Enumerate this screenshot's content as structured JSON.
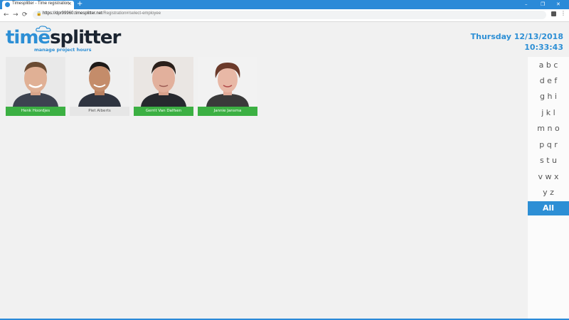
{
  "browser": {
    "tab_title": "Timesplitter - Time registration",
    "tab_close": "×",
    "new_tab": "+",
    "url_host": "https://dpr99960.timesplitter.net",
    "url_path": "/Registration#/select-employee",
    "minimize": "–",
    "maximize": "❐",
    "close": "✕",
    "back": "←",
    "forward": "→",
    "reload": "⟳",
    "menu": "⋮"
  },
  "app": {
    "logo_time": "time",
    "logo_splitter": "splitter",
    "logo_tagline": "manage project hours",
    "date": "Thursday 12/13/2018",
    "time": "10:33:43"
  },
  "employees": [
    {
      "name": "Henk Hoordjes",
      "style": "green"
    },
    {
      "name": "Piet Alberts",
      "style": "plain"
    },
    {
      "name": "Gerrit Van Dalfsen",
      "style": "green"
    },
    {
      "name": "Jannie Jansma",
      "style": "green"
    }
  ],
  "alphabet": [
    "a b c",
    "d e f",
    "g h i",
    "j k l",
    "m n o",
    "p q r",
    "s t u",
    "v w x",
    "y z",
    "All"
  ],
  "colors": {
    "accent": "#2d8fd5",
    "name_bar": "#3cb043"
  }
}
